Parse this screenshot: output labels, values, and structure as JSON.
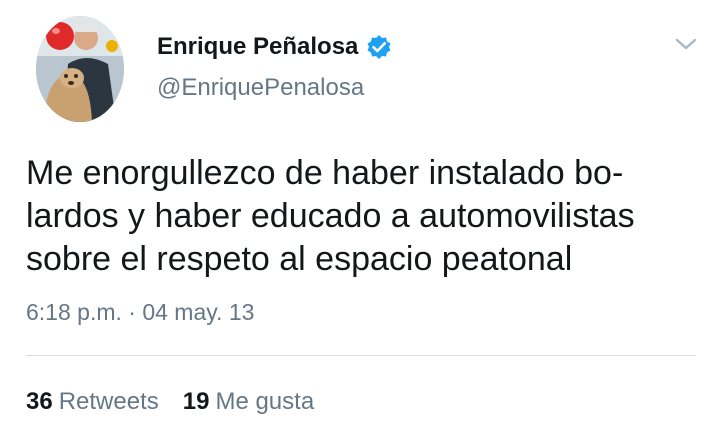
{
  "tweet": {
    "author": {
      "name": "Enrique Peñalosa",
      "handle": "@EnriquePenalosa",
      "verified": true,
      "avatar_icon": "profile-photo-man-with-dog-and-red-balloon"
    },
    "text": "Me enorgullezco de haber instalado bo-\nlardos y haber educado a automovilistas\nsobre el respeto al espacio peatonal",
    "timestamp": "6:18 p.m. · 04 may. 13",
    "stats": {
      "retweets_count": "36",
      "retweets_label": "Retweets",
      "likes_count": "19",
      "likes_label": "Me gusta"
    },
    "menu_icon": "chevron-down-icon"
  },
  "colors": {
    "text_primary": "#14171a",
    "text_secondary": "#657786",
    "verified_blue": "#1da1f2",
    "divider": "#d8dde1"
  }
}
